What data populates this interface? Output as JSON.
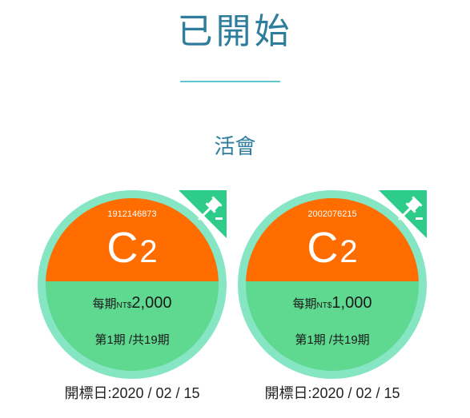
{
  "page": {
    "title": "已開始",
    "subtitle": "活會"
  },
  "colors": {
    "title": "#2e7d9c",
    "rule": "#5cc9cf",
    "orange": "#ff6c00",
    "green": "#5fd890",
    "ring": "#86e6c3",
    "corner": "#2ecc8a"
  },
  "cards": [
    {
      "serial": "1912146873",
      "code_letter": "C",
      "code_number": "2",
      "amount_label": "每期",
      "amount_unit": "NT$",
      "amount": "2,000",
      "period": "第1期 /共19期",
      "bid_date": "開標日:2020 / 02 / 15",
      "icon": "gavel-icon"
    },
    {
      "serial": "2002076215",
      "code_letter": "C",
      "code_number": "2",
      "amount_label": "每期",
      "amount_unit": "NT$",
      "amount": "1,000",
      "period": "第1期 /共19期",
      "bid_date": "開標日:2020 / 02 / 15",
      "icon": "gavel-icon"
    }
  ]
}
